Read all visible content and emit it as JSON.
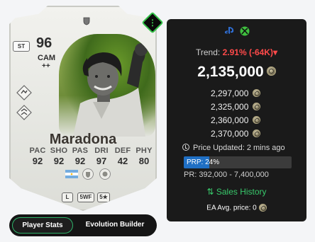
{
  "card": {
    "rating": "96",
    "position": "CAM",
    "plus": "++",
    "alt_position": "ST",
    "name": "Maradona",
    "stats": [
      {
        "label": "PAC",
        "value": "92"
      },
      {
        "label": "SHO",
        "value": "92"
      },
      {
        "label": "PAS",
        "value": "92"
      },
      {
        "label": "DRI",
        "value": "97"
      },
      {
        "label": "DEF",
        "value": "42"
      },
      {
        "label": "PHY",
        "value": "80"
      }
    ],
    "pills": {
      "foot": "L",
      "weak_foot": "5WF",
      "skills": "5★"
    },
    "menu_icon": "⋮"
  },
  "panel": {
    "trend_label": "Trend:",
    "trend_value": "2.91% (-64K)",
    "trend_arrow": "▾",
    "price": "2,135,000",
    "other_prices": [
      "2,297,000",
      "2,325,000",
      "2,360,000",
      "2,370,000"
    ],
    "updated": "Price Updated: 2 mins ago",
    "prp_label": "PRP: 24%",
    "prp_value": 0.24,
    "price_range": "PR: 392,000 - 7,400,000",
    "sales_history": "Sales History",
    "sales_icon": "⇅",
    "ea_avg": "EA Avg. price: 0"
  },
  "tabs": {
    "player_stats": "Player Stats",
    "evolution_builder": "Evolution Builder"
  },
  "colors": {
    "accent_green": "#2fb36a",
    "trend_red": "#ff4a4a",
    "prp_blue": "#1f6fc4",
    "panel_bg": "#1a1a1a"
  }
}
